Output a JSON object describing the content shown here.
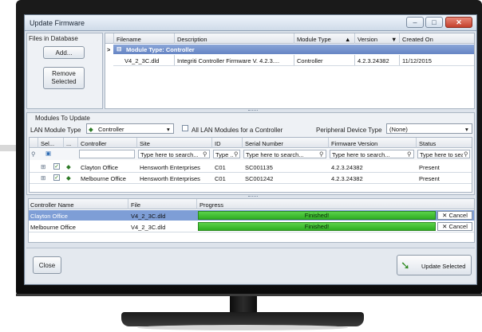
{
  "window": {
    "title": "Update Firmware"
  },
  "files_in_database": {
    "label": "Files in Database",
    "add_button": "Add...",
    "remove_button": "Remove\nSelected"
  },
  "firmware_grid": {
    "columns": [
      "Filename",
      "Description",
      "Module Type",
      "Version",
      "Created On"
    ],
    "group_label": "Module Type: Controller",
    "row": {
      "filename": "V4_2_3C.dld",
      "description": "Integriti Controller Firmware V. 4.2.3....",
      "module_type": "Controller",
      "version": "4.2.3.24382",
      "created_on": "11/12/2015"
    }
  },
  "modules_to_update": {
    "label": "Modules To Update",
    "lan_module_type_label": "LAN Module Type",
    "lan_module_type_value": "Controller",
    "all_lan_modules_label": "All LAN Modules for a Controller",
    "peripheral_device_type_label": "Peripheral Device Type",
    "peripheral_device_type_value": "(None)",
    "columns": [
      "Sel...",
      "...",
      "Controller",
      "Site",
      "ID",
      "Serial Number",
      "Firmware Version",
      "Status"
    ],
    "filters": {
      "site": "Type here to search...",
      "id": "Type ...",
      "serial": "Type here to search...",
      "firmware": "Type here to search...",
      "status": "Type here to sea"
    },
    "rows": [
      {
        "controller": "Clayton Office",
        "site": "Hensworth Enterprises",
        "id": "C01",
        "serial": "SC001135",
        "firmware": "4.2.3.24382",
        "status": "Present"
      },
      {
        "controller": "Melbourne Office",
        "site": "Hensworth Enterprises",
        "id": "C01",
        "serial": "SC001242",
        "firmware": "4.2.3.24382",
        "status": "Present"
      }
    ]
  },
  "progress_grid": {
    "columns": [
      "Controller Name",
      "File",
      "Progress"
    ],
    "rows": [
      {
        "controller": "Clayton Office",
        "file": "V4_2_3C.dld",
        "progress_text": "Finished!",
        "progress": 1.0,
        "cancel": "✕ Cancel"
      },
      {
        "controller": "Melbourne Office",
        "file": "V4_2_3C.dld",
        "progress_text": "Finished!",
        "progress": 1.0,
        "cancel": "✕ Cancel"
      }
    ]
  },
  "footer": {
    "close_button": "Close",
    "update_button": "Update Selected"
  },
  "colors": {
    "accent": "#6584c4",
    "progress": "#3cbf2e",
    "close": "#c4402c"
  }
}
